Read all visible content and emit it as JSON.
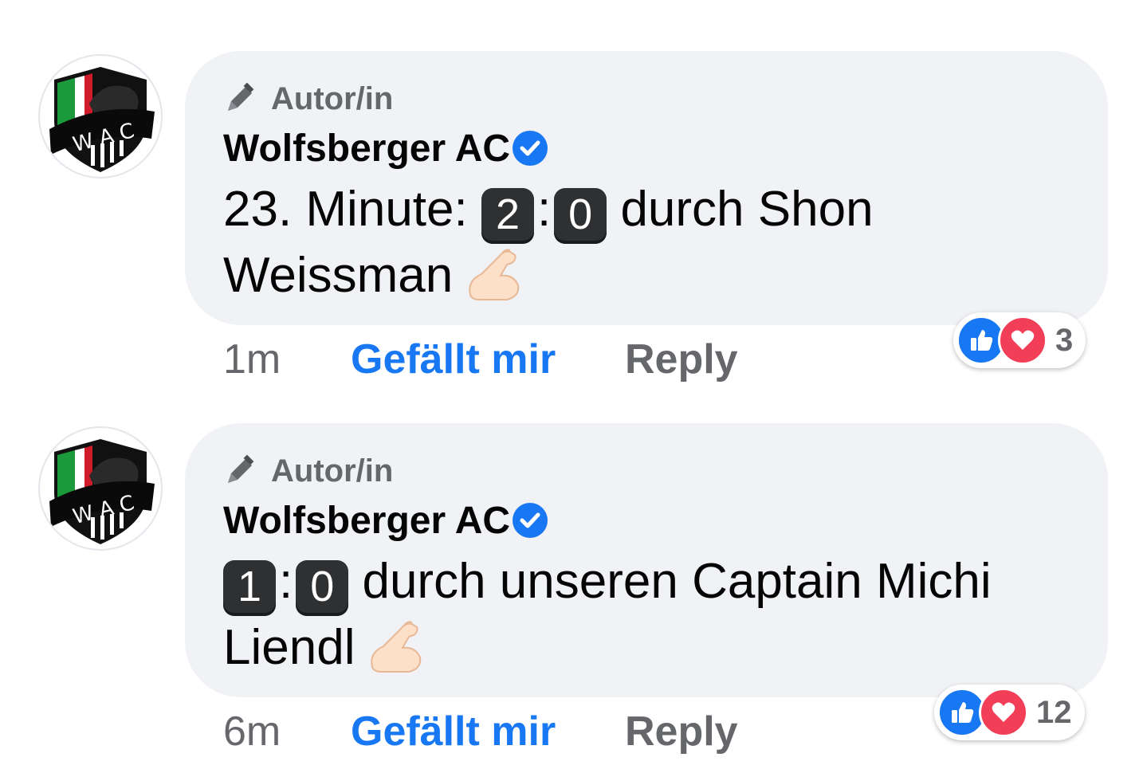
{
  "colors": {
    "bubble_bg": "#f0f2f5",
    "link_blue": "#1877f2",
    "meta_gray": "#65676b",
    "text_dark": "#050505",
    "love_red": "#f33e58"
  },
  "comments": [
    {
      "role_icon": "pencil-icon",
      "role_label": "Autor/in",
      "author": "Wolfsberger AC",
      "verified_icon": "verified-badge-icon",
      "text_prefix": "23. Minute:",
      "score_home": "2",
      "score_sep": ":",
      "score_away": "0",
      "text_suffix_line1": "durch Shon",
      "text_line2": "Weissman",
      "emoji": "flexed-biceps-emoji",
      "time": "1m",
      "like_label": "Gefällt mir",
      "reply_label": "Reply",
      "reaction_count": "3"
    },
    {
      "role_icon": "pencil-icon",
      "role_label": "Autor/in",
      "author": "Wolfsberger AC",
      "verified_icon": "verified-badge-icon",
      "score_home": "1",
      "score_sep": ":",
      "score_away": "0",
      "text_suffix_line1": "durch unseren Captain Michi",
      "text_line2": "Liendl",
      "emoji": "flexed-biceps-emoji",
      "time": "6m",
      "like_label": "Gefällt mir",
      "reply_label": "Reply",
      "reaction_count": "12"
    }
  ]
}
